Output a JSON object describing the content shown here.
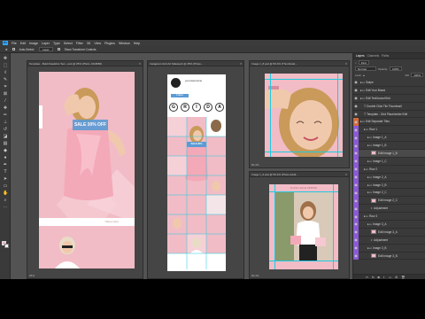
{
  "menu": [
    "File",
    "Edit",
    "Image",
    "Layer",
    "Type",
    "Select",
    "Filter",
    "3D",
    "View",
    "Plugins",
    "Window",
    "Help"
  ],
  "options": {
    "auto_select_label": "Auto-Select:",
    "auto_select_value": "Layer",
    "transform_label": "Show Transform Controls"
  },
  "documents": {
    "doc1": {
      "title": "Template - Bold Roadshot Tem...psd @ 25% (Photo, RGB/8#)",
      "zoom": "25%",
      "sale_text": "SALE 30% OFF",
      "footer_text": "Name Here"
    },
    "doc2": {
      "title": "Instagram Grid Art Makeupb @ 25% (Photo...",
      "profile_name": "yourusername",
      "letters": [
        "G",
        "R",
        "I",
        "D",
        "A"
      ],
      "follow_label": "Follow",
      "sale_text": "SALE 30%"
    },
    "doc3": {
      "title": "Image 1_8.psd @ 50.4% (Thumbnail,...",
      "zoom": "50.4%"
    },
    "doc4": {
      "title": "Image 1_6.psd @ 50.4% (Photo Addit...",
      "zoom": "50.4%",
      "caption": "FLASH SALE SPRING"
    }
  },
  "panel": {
    "tabs": [
      "Layers",
      "Channels",
      "Paths"
    ],
    "blend_mode": "Normal",
    "opacity_label": "Opacity:",
    "opacity_value": "100%",
    "lock_label": "Lock:",
    "fill_label": "Fill:",
    "fill_value": "100%",
    "kind_label": "Kind",
    "layers": [
      {
        "name": "Swipe",
        "color": "",
        "type": "group",
        "indent": 0
      },
      {
        "name": "Edit Your Brand",
        "color": "",
        "type": "group",
        "indent": 0
      },
      {
        "name": "Edit Text/Icons/Grid",
        "color": "",
        "type": "group",
        "indent": 0
      },
      {
        "name": "Double Click Tile Thumbnail",
        "color": "",
        "type": "text",
        "indent": 1
      },
      {
        "name": "Template - Grid Placeholder Edit",
        "color": "",
        "type": "text",
        "indent": 1
      },
      {
        "name": "Edit Separate Tiles",
        "color": "#d26a3c",
        "type": "group",
        "indent": 0
      },
      {
        "name": "Row 1",
        "color": "#8a5ad2",
        "type": "group",
        "indent": 1
      },
      {
        "name": "Image 1_A",
        "color": "#8a5ad2",
        "type": "group",
        "indent": 2
      },
      {
        "name": "Image 1_B",
        "color": "#8a5ad2",
        "type": "group",
        "indent": 2
      },
      {
        "name": "Edit Image 1_B",
        "color": "#8a5ad2",
        "type": "smart",
        "indent": 3
      },
      {
        "name": "Image 1_C",
        "color": "#8a5ad2",
        "type": "group",
        "indent": 2
      },
      {
        "name": "Row 2",
        "color": "#8a5ad2",
        "type": "group",
        "indent": 1
      },
      {
        "name": "Image 2_A",
        "color": "#8a5ad2",
        "type": "group",
        "indent": 2
      },
      {
        "name": "Image 2_B",
        "color": "#8a5ad2",
        "type": "group",
        "indent": 2
      },
      {
        "name": "Image 2_C",
        "color": "#8a5ad2",
        "type": "group",
        "indent": 2
      },
      {
        "name": "Edit Image 2_C",
        "color": "#8a5ad2",
        "type": "smart",
        "indent": 3
      },
      {
        "name": "Adjustment",
        "color": "#8a5ad2",
        "type": "fx",
        "indent": 3
      },
      {
        "name": "Row 3",
        "color": "#8a5ad2",
        "type": "group",
        "indent": 1
      },
      {
        "name": "Image 3_A",
        "color": "#8a5ad2",
        "type": "group",
        "indent": 2
      },
      {
        "name": "Edit Image 3_A",
        "color": "#8a5ad2",
        "type": "smart",
        "indent": 3
      },
      {
        "name": "Adjustment",
        "color": "#8a5ad2",
        "type": "fx",
        "indent": 3
      },
      {
        "name": "Image 3_B",
        "color": "#8a5ad2",
        "type": "group",
        "indent": 2
      },
      {
        "name": "Edit Image 3_B",
        "color": "#8a5ad2",
        "type": "smart",
        "indent": 3
      }
    ],
    "footer_icons": [
      "link-icon",
      "fx-icon",
      "mask-icon",
      "adjustment-icon",
      "folder-icon",
      "new-layer-icon",
      "trash-icon"
    ]
  },
  "colors": {
    "pink": "#f1bcc6",
    "ps_bg": "#535353",
    "guide": "#1ecbe1",
    "sale_blue": "#5b9bd5"
  }
}
